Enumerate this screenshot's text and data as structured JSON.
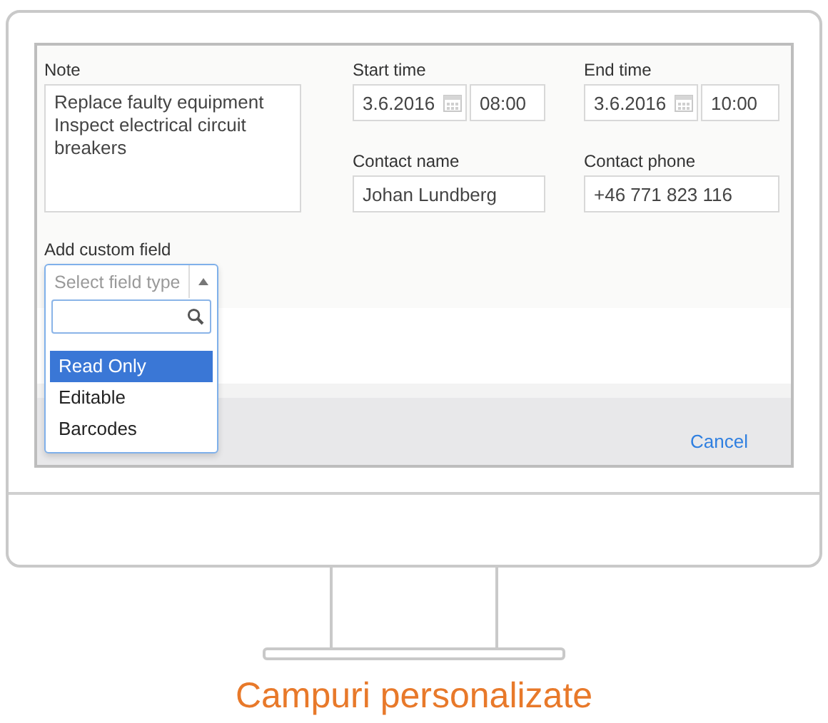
{
  "note": {
    "label": "Note",
    "value": "Replace faulty equipment\nInspect electrical circuit breakers"
  },
  "start_time": {
    "label": "Start time",
    "date": "3.6.2016",
    "time": "08:00"
  },
  "end_time": {
    "label": "End time",
    "date": "3.6.2016",
    "time": "10:00"
  },
  "contact_name": {
    "label": "Contact name",
    "value": "Johan Lundberg"
  },
  "contact_phone": {
    "label": "Contact phone",
    "value": "+46 771 823 116"
  },
  "custom_field": {
    "label": "Add custom field",
    "placeholder": "Select field type",
    "expanded": true,
    "options": [
      {
        "label": "Read Only",
        "selected": true
      },
      {
        "label": "Editable",
        "selected": false
      },
      {
        "label": "Barcodes",
        "selected": false
      }
    ]
  },
  "footer": {
    "cancel": "Cancel"
  },
  "caption": "Campuri personalizate"
}
